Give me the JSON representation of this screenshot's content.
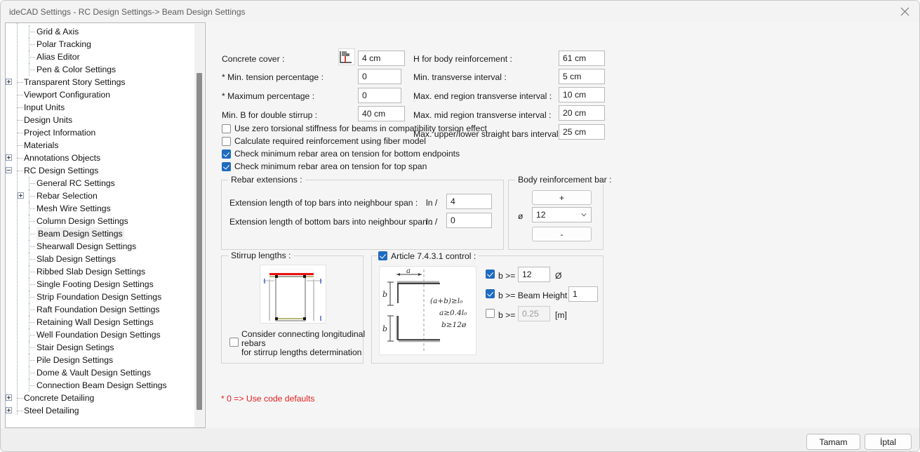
{
  "window": {
    "title": "ideCAD Settings - RC Design Settings-> Beam Design Settings",
    "close_icon": "close-icon"
  },
  "sidebar": {
    "items": [
      {
        "label": "Grid & Axis",
        "depth": 2,
        "expander": "none"
      },
      {
        "label": "Polar Tracking",
        "depth": 2,
        "expander": "none"
      },
      {
        "label": "Alias Editor",
        "depth": 2,
        "expander": "none"
      },
      {
        "label": "Pen & Color Settings",
        "depth": 2,
        "expander": "none"
      },
      {
        "label": "Transparent Story Settings",
        "depth": 1,
        "expander": "plus"
      },
      {
        "label": "Viewport Configuration",
        "depth": 1,
        "expander": "none"
      },
      {
        "label": "Input Units",
        "depth": 1,
        "expander": "none"
      },
      {
        "label": "Design Units",
        "depth": 1,
        "expander": "none"
      },
      {
        "label": "Project Information",
        "depth": 1,
        "expander": "none"
      },
      {
        "label": "Materials",
        "depth": 1,
        "expander": "none"
      },
      {
        "label": "Annotations Objects",
        "depth": 1,
        "expander": "plus"
      },
      {
        "label": "RC Design Settings",
        "depth": 1,
        "expander": "minus"
      },
      {
        "label": "General RC Settings",
        "depth": 2,
        "expander": "none"
      },
      {
        "label": "Rebar Selection",
        "depth": 2,
        "expander": "plus"
      },
      {
        "label": "Mesh Wire Settings",
        "depth": 2,
        "expander": "none"
      },
      {
        "label": "Column Design Settings",
        "depth": 2,
        "expander": "none"
      },
      {
        "label": "Beam Design Settings",
        "depth": 2,
        "expander": "none",
        "selected": true
      },
      {
        "label": "Shearwall Design Settings",
        "depth": 2,
        "expander": "none"
      },
      {
        "label": "Slab Design Settings",
        "depth": 2,
        "expander": "none"
      },
      {
        "label": "Ribbed Slab Design Settings",
        "depth": 2,
        "expander": "none"
      },
      {
        "label": "Single Footing Design Settings",
        "depth": 2,
        "expander": "none"
      },
      {
        "label": "Strip Foundation Design Settings",
        "depth": 2,
        "expander": "none"
      },
      {
        "label": "Raft Foundation Design Settings",
        "depth": 2,
        "expander": "none"
      },
      {
        "label": "Retaining Wall Design Settings",
        "depth": 2,
        "expander": "none"
      },
      {
        "label": "Well Foundation Design Settings",
        "depth": 2,
        "expander": "none"
      },
      {
        "label": "Stair Design Setings",
        "depth": 2,
        "expander": "none"
      },
      {
        "label": "Pile Design Settings",
        "depth": 2,
        "expander": "none"
      },
      {
        "label": "Dome & Vault Design Settings",
        "depth": 2,
        "expander": "none"
      },
      {
        "label": "Connection Beam Design Settings",
        "depth": 2,
        "expander": "none"
      },
      {
        "label": "Concrete Detailing",
        "depth": 1,
        "expander": "plus"
      },
      {
        "label": "Steel Detailing",
        "depth": 1,
        "expander": "plus"
      }
    ]
  },
  "form": {
    "left": {
      "concrete_cover_label": "Concrete cover :",
      "concrete_cover_value": "4 cm",
      "concrete_cover_icon": "concrete-cover-icon",
      "min_tension_label": "* Min. tension percentage :",
      "min_tension_value": "0",
      "max_percentage_label": "* Maximum percentage :",
      "max_percentage_value": "0",
      "min_b_double_stirrup_label": "Min. B for double stirrup :",
      "min_b_double_stirrup_value": "40 cm"
    },
    "right": {
      "h_body_reinforcement_label": "H for body reinforcement :",
      "h_body_reinforcement_value": "61 cm",
      "min_transverse_label": "Min. transverse interval :",
      "min_transverse_value": "5 cm",
      "max_end_transverse_label": "Max. end region transverse interval :",
      "max_end_transverse_value": "10 cm",
      "max_mid_transverse_label": "Max. mid region transverse interval :",
      "max_mid_transverse_value": "20 cm",
      "max_straight_bars_label": "Max. upper/lower straight bars interval :",
      "max_straight_bars_value": "25 cm"
    }
  },
  "checkboxes": [
    {
      "label": "Use zero torsional stiffness for beams in compatibility torsion effect",
      "checked": false
    },
    {
      "label": "Calculate required reinforcement using fiber model",
      "checked": false
    },
    {
      "label": "Check minimum rebar area on tension for bottom endpoints",
      "checked": true
    },
    {
      "label": "Check minimum rebar area on tension for top span",
      "checked": true
    }
  ],
  "rebar_extensions": {
    "title": "Rebar extensions :",
    "top_label": "Extension length of top bars into neighbour span :",
    "top_prefix": "ln /",
    "top_value": "4",
    "bottom_label": "Extension length of bottom bars into neighbour span :",
    "bottom_prefix": "ln /",
    "bottom_value": "0"
  },
  "body_reinforcement": {
    "title": "Body reinforcement bar :",
    "plus_label": "+",
    "minus_label": "-",
    "diameter_symbol": "ø",
    "diameter_value": "12"
  },
  "stirrup_lengths": {
    "title": "Stirrup lengths :",
    "diagram_icon": "beam-section-diagram",
    "checkbox_line1": "Consider connecting longitudinal",
    "checkbox_line2": "rebars",
    "checkbox_line3": "for stirrup lengths determination",
    "checked": false
  },
  "article_control": {
    "title": "Article 7.4.3.1 control :",
    "enabled": true,
    "diagram_icon": "hook-detail-diagram",
    "diagram_notes": [
      "(a+b) ≥ l₀",
      "a ≥ 0.4 l₀",
      "b ≥ 12ø"
    ],
    "rows": [
      {
        "checked": true,
        "label": "b >=",
        "value": "12",
        "suffix": "Ø",
        "disabled": false
      },
      {
        "checked": true,
        "label": "b >= Beam Height /",
        "value": "1",
        "suffix": "",
        "disabled": false
      },
      {
        "checked": false,
        "label": "b >=",
        "value": "0.25",
        "suffix": "[m]",
        "disabled": true
      }
    ]
  },
  "footnote": "* 0 => Use code defaults",
  "footer": {
    "ok_label": "Tamam",
    "cancel_label": "İptal"
  },
  "colors": {
    "accent": "#1f6bc0",
    "warning": "#e02020",
    "window_bg": "#f5f5f5",
    "titlebar_bg": "#f3f3f3"
  }
}
